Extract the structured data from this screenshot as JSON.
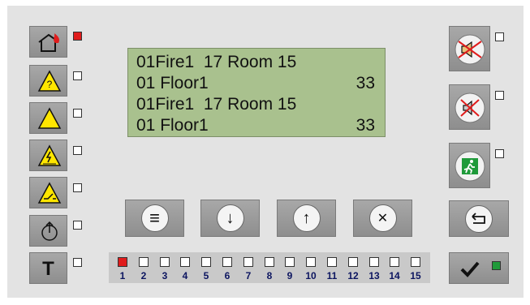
{
  "display": {
    "lines": [
      {
        "left": "01Fire1  17 Room 15",
        "right": ""
      },
      {
        "left": "01 Floor1",
        "right": "33"
      },
      {
        "left": "01Fire1  17 Room 15",
        "right": ""
      },
      {
        "left": "01 Floor1",
        "right": "33"
      }
    ]
  },
  "left_buttons": [
    {
      "icon": "fire-house-icon",
      "indicator_color": "#e01c1c"
    },
    {
      "icon": "question-warning-icon",
      "indicator_color": "#ffffff"
    },
    {
      "icon": "warning-triangle-icon",
      "indicator_color": "#ffffff"
    },
    {
      "icon": "electrical-warning-icon",
      "indicator_color": "#ffffff"
    },
    {
      "icon": "switch-warning-icon",
      "indicator_color": "#ffffff"
    },
    {
      "icon": "power-circle-icon",
      "indicator_color": "#ffffff"
    },
    {
      "icon": "test-t-icon",
      "label": "T",
      "indicator_color": "#ffffff"
    }
  ],
  "right_buttons": [
    {
      "icon": "speaker-muted-icon",
      "indicator_color": "#ffffff"
    },
    {
      "icon": "buzzer-muted-icon",
      "indicator_color": "#ffffff"
    },
    {
      "icon": "emergency-exit-icon",
      "indicator_color": "#ffffff"
    },
    {
      "icon": "return-icon",
      "indicator_color": null
    },
    {
      "icon": "checkmark-icon",
      "indicator_color": "#1f9a3a"
    }
  ],
  "bottom_buttons": [
    {
      "icon": "menu-icon",
      "glyph": "≡"
    },
    {
      "icon": "arrow-down-icon",
      "glyph": "↓"
    },
    {
      "icon": "arrow-up-icon",
      "glyph": "↑"
    },
    {
      "icon": "close-icon",
      "glyph": "✕"
    }
  ],
  "zones": [
    {
      "number": "1",
      "active": true
    },
    {
      "number": "2",
      "active": false
    },
    {
      "number": "3",
      "active": false
    },
    {
      "number": "4",
      "active": false
    },
    {
      "number": "5",
      "active": false
    },
    {
      "number": "6",
      "active": false
    },
    {
      "number": "7",
      "active": false
    },
    {
      "number": "8",
      "active": false
    },
    {
      "number": "9",
      "active": false
    },
    {
      "number": "10",
      "active": false
    },
    {
      "number": "11",
      "active": false
    },
    {
      "number": "12",
      "active": false
    },
    {
      "number": "13",
      "active": false
    },
    {
      "number": "14",
      "active": false
    },
    {
      "number": "15",
      "active": false
    }
  ],
  "colors": {
    "panel": "#e3e3e3",
    "lcd": "#a9c18e",
    "active_led": "#e01c1c",
    "ok_led": "#1f9a3a",
    "zone_number": "#0c1560"
  }
}
